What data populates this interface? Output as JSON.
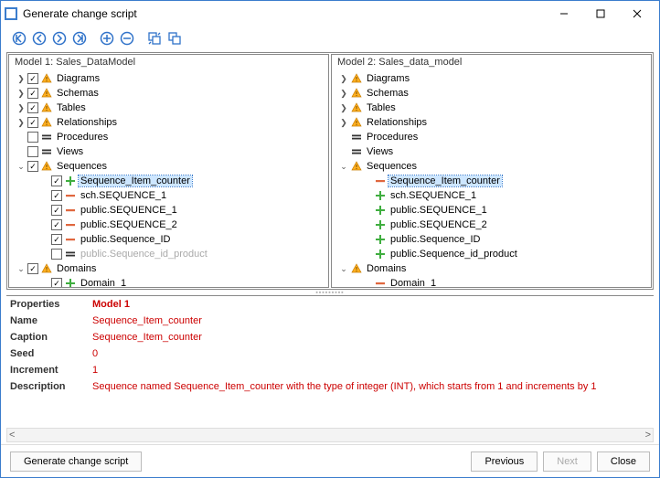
{
  "window": {
    "title": "Generate change script"
  },
  "models": {
    "left": {
      "header": "Model 1: Sales_DataModel"
    },
    "right": {
      "header": "Model 2: Sales_data_model"
    }
  },
  "treeLeft": [
    {
      "d": 0,
      "tw": ">",
      "chk": true,
      "ic": "warn",
      "label": "Diagrams"
    },
    {
      "d": 0,
      "tw": ">",
      "chk": true,
      "ic": "warn",
      "label": "Schemas"
    },
    {
      "d": 0,
      "tw": ">",
      "chk": true,
      "ic": "warn",
      "label": "Tables"
    },
    {
      "d": 0,
      "tw": ">",
      "chk": true,
      "ic": "warn",
      "label": "Relationships"
    },
    {
      "d": 0,
      "tw": "",
      "chk": false,
      "ic": "eq",
      "label": "Procedures"
    },
    {
      "d": 0,
      "tw": "",
      "chk": false,
      "ic": "eq",
      "label": "Views"
    },
    {
      "d": 0,
      "tw": "v",
      "chk": true,
      "ic": "warn",
      "label": "Sequences"
    },
    {
      "d": 1,
      "tw": "",
      "chk": true,
      "ic": "plus",
      "label": "Sequence_Item_counter",
      "sel": true
    },
    {
      "d": 1,
      "tw": "",
      "chk": true,
      "ic": "minus",
      "label": "sch.SEQUENCE_1"
    },
    {
      "d": 1,
      "tw": "",
      "chk": true,
      "ic": "minus",
      "label": "public.SEQUENCE_1"
    },
    {
      "d": 1,
      "tw": "",
      "chk": true,
      "ic": "minus",
      "label": "public.SEQUENCE_2"
    },
    {
      "d": 1,
      "tw": "",
      "chk": true,
      "ic": "minus",
      "label": "public.Sequence_ID"
    },
    {
      "d": 1,
      "tw": "",
      "chk": false,
      "ic": "eq",
      "label": "public.Sequence_id_product",
      "gray": true
    },
    {
      "d": 0,
      "tw": "v",
      "chk": true,
      "ic": "warn",
      "label": "Domains"
    },
    {
      "d": 1,
      "tw": "",
      "chk": true,
      "ic": "plus",
      "label": "Domain_1"
    }
  ],
  "treeRight": [
    {
      "d": 0,
      "tw": ">",
      "ic": "warn",
      "label": "Diagrams"
    },
    {
      "d": 0,
      "tw": ">",
      "ic": "warn",
      "label": "Schemas"
    },
    {
      "d": 0,
      "tw": ">",
      "ic": "warn",
      "label": "Tables"
    },
    {
      "d": 0,
      "tw": ">",
      "ic": "warn",
      "label": "Relationships"
    },
    {
      "d": 0,
      "tw": "",
      "ic": "eq",
      "label": "Procedures"
    },
    {
      "d": 0,
      "tw": "",
      "ic": "eq",
      "label": "Views"
    },
    {
      "d": 0,
      "tw": "v",
      "ic": "warn",
      "label": "Sequences"
    },
    {
      "d": 1,
      "tw": "",
      "ic": "minus",
      "label": "Sequence_Item_counter",
      "sel": true
    },
    {
      "d": 1,
      "tw": "",
      "ic": "plus",
      "label": "sch.SEQUENCE_1"
    },
    {
      "d": 1,
      "tw": "",
      "ic": "plus",
      "label": "public.SEQUENCE_1"
    },
    {
      "d": 1,
      "tw": "",
      "ic": "plus",
      "label": "public.SEQUENCE_2"
    },
    {
      "d": 1,
      "tw": "",
      "ic": "plus",
      "label": "public.Sequence_ID"
    },
    {
      "d": 1,
      "tw": "",
      "ic": "plus",
      "label": "public.Sequence_id_product"
    },
    {
      "d": 0,
      "tw": "v",
      "ic": "warn",
      "label": "Domains"
    },
    {
      "d": 1,
      "tw": "",
      "ic": "minus",
      "label": "Domain_1"
    }
  ],
  "props": {
    "header": {
      "k": "Properties",
      "v": "Model 1"
    },
    "rows": [
      {
        "k": "Name",
        "v": "Sequence_Item_counter"
      },
      {
        "k": "Caption",
        "v": "Sequence_Item_counter"
      },
      {
        "k": "Seed",
        "v": "0"
      },
      {
        "k": "Increment",
        "v": "1"
      },
      {
        "k": "Description",
        "v": "Sequence named Sequence_Item_counter with the type of integer (INT), which starts from 1 and increments by 1"
      }
    ]
  },
  "buttons": {
    "generate": "Generate change script",
    "previous": "Previous",
    "next": "Next",
    "close": "Close"
  }
}
